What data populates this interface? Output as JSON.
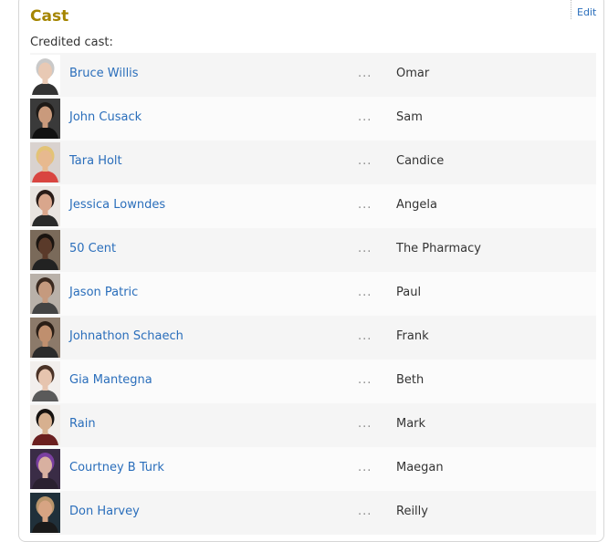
{
  "section": {
    "title": "Cast",
    "edit_label": "Edit",
    "subheading": "Credited cast:"
  },
  "separator": "...",
  "colors": {
    "title": "#a58500",
    "link": "#2a6ebb",
    "row_odd": "#f5f5f5",
    "row_even": "#fbfbfb"
  },
  "cast": [
    {
      "actor": "Bruce Willis",
      "character": "Omar",
      "photo": {
        "skin": "#e8c9b4",
        "hair": "#c9c9c9",
        "bg": "#ffffff",
        "shirt": "#333333"
      }
    },
    {
      "actor": "John Cusack",
      "character": "Sam",
      "photo": {
        "skin": "#c99a7c",
        "hair": "#1e1a17",
        "bg": "#3a3a3a",
        "shirt": "#111111"
      }
    },
    {
      "actor": "Tara Holt",
      "character": "Candice",
      "photo": {
        "skin": "#e7b98f",
        "hair": "#e3c376",
        "bg": "#d9d2cf",
        "shirt": "#d94540"
      }
    },
    {
      "actor": "Jessica Lowndes",
      "character": "Angela",
      "photo": {
        "skin": "#d9a68c",
        "hair": "#2a1c18",
        "bg": "#e9e4e0",
        "shirt": "#2a2a2a"
      }
    },
    {
      "actor": "50 Cent",
      "character": "The Pharmacy",
      "photo": {
        "skin": "#5a3a2a",
        "hair": "#1a1410",
        "bg": "#7a6a5a",
        "shirt": "#222222"
      }
    },
    {
      "actor": "Jason Patric",
      "character": "Paul",
      "photo": {
        "skin": "#c59a7e",
        "hair": "#3b2a20",
        "bg": "#b9b1a9",
        "shirt": "#444444"
      }
    },
    {
      "actor": "Johnathon Schaech",
      "character": "Frank",
      "photo": {
        "skin": "#bf8f6e",
        "hair": "#2a1e16",
        "bg": "#8c7a6a",
        "shirt": "#2b2b2b"
      }
    },
    {
      "actor": "Gia Mantegna",
      "character": "Beth",
      "photo": {
        "skin": "#e6c4ae",
        "hair": "#4a3226",
        "bg": "#f2efed",
        "shirt": "#5a5a5a"
      }
    },
    {
      "actor": "Rain",
      "character": "Mark",
      "photo": {
        "skin": "#d7b08f",
        "hair": "#17120f",
        "bg": "#f0ece8",
        "shirt": "#6b1f1f"
      }
    },
    {
      "actor": "Courtney B Turk",
      "character": "Maegan",
      "photo": {
        "skin": "#d8b0a0",
        "hair": "#7a3fa0",
        "bg": "#3a2c46",
        "shirt": "#2a2030"
      }
    },
    {
      "actor": "Don Harvey",
      "character": "Reilly",
      "photo": {
        "skin": "#d7a483",
        "hair": "#b8956b",
        "bg": "#20303a",
        "shirt": "#1a1a1a"
      }
    }
  ]
}
